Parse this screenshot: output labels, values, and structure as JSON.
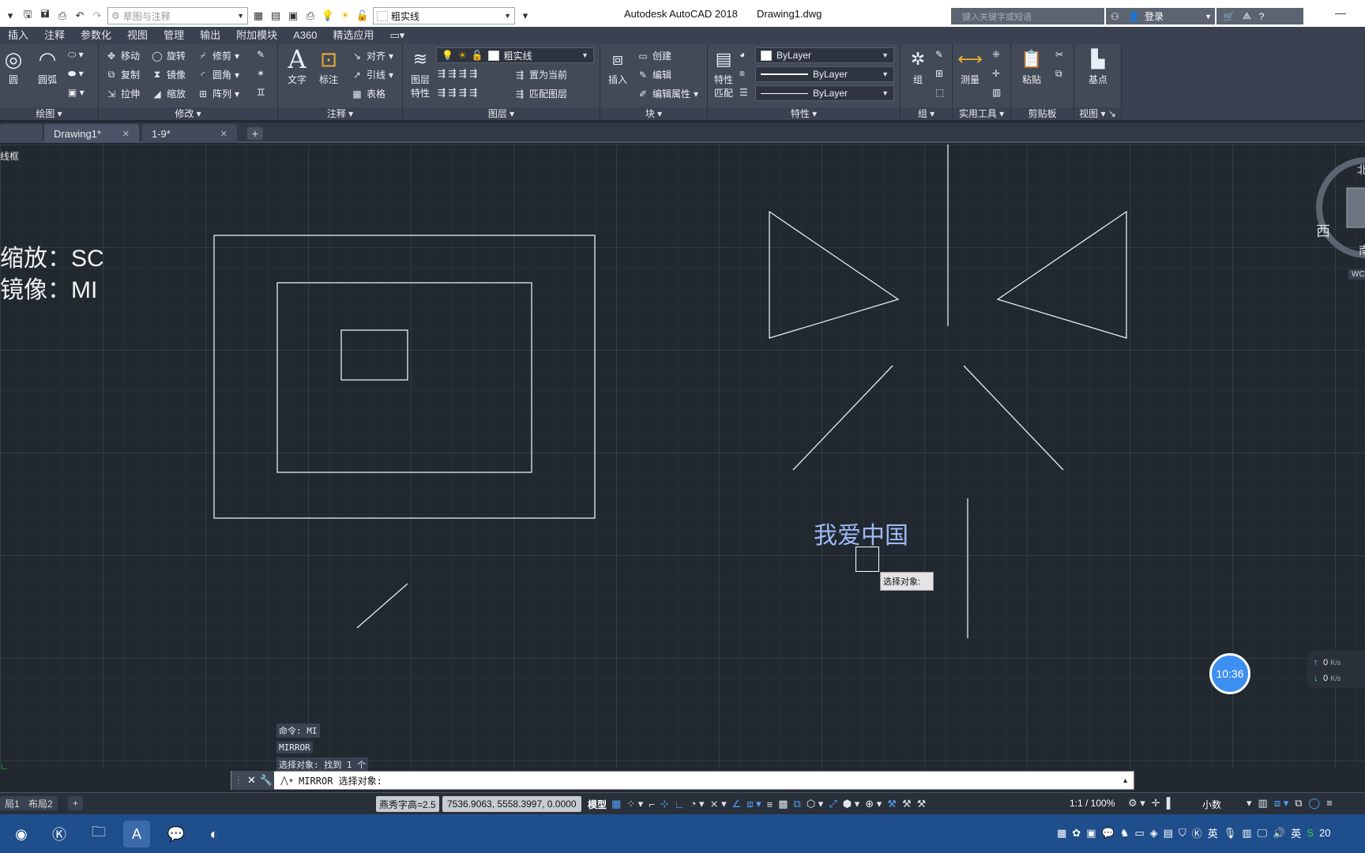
{
  "titlebar": {
    "workspace_placeholder": "草图与注释",
    "layer_name": "粗实线",
    "app_title": "Autodesk AutoCAD 2018",
    "doc_title": "Drawing1.dwg",
    "search_placeholder": "键入关键字或短语",
    "login_label": "登录",
    "minimize_glyph": "—"
  },
  "ribbon_tabs": [
    "插入",
    "注释",
    "参数化",
    "视图",
    "管理",
    "输出",
    "附加模块",
    "A360",
    "精选应用"
  ],
  "panels": {
    "draw": {
      "label": "绘图",
      "circle": "圆",
      "arc": "圆弧"
    },
    "modify": {
      "label": "修改",
      "move": "移动",
      "rotate": "旋转",
      "trim": "修剪",
      "copy": "复制",
      "mirror": "镜像",
      "fillet": "圆角",
      "stretch": "拉伸",
      "scale": "缩放",
      "array": "阵列"
    },
    "annotation": {
      "label": "注释",
      "text": "文字",
      "dimension": "标注",
      "align": "对齐",
      "leader": "引线",
      "table": "表格"
    },
    "layers": {
      "label": "图层",
      "layer_props_line1": "图层",
      "layer_props_line2": "特性",
      "layer_name": "粗实线",
      "set_current": "置为当前",
      "match_layer": "匹配图层"
    },
    "block": {
      "label": "块",
      "insert": "插入",
      "create": "创建",
      "edit": "编辑",
      "edit_attr": "编辑属性"
    },
    "properties": {
      "label": "特性",
      "match_line1": "特性",
      "match_line2": "匹配",
      "color": "ByLayer",
      "linetype": "ByLayer",
      "lineweight": "ByLayer"
    },
    "groups": {
      "label": "组",
      "group": "组"
    },
    "utilities": {
      "label": "实用工具",
      "measure": "测量"
    },
    "clipboard": {
      "label": "剪贴板",
      "paste": "粘贴"
    },
    "view": {
      "label": "视图",
      "base": "基点"
    }
  },
  "doc_tabs": [
    {
      "label": "Drawing1*",
      "active": true
    },
    {
      "label": "1-9*",
      "active": false
    }
  ],
  "canvas": {
    "viewport_label": "线框",
    "notes": [
      "缩放：SC",
      "镜像：MI"
    ],
    "text_object": "我爱中国",
    "tooltip": "选择对象:",
    "viewcube_west": "西",
    "viewcube_top_fragment": "北",
    "viewcube_bottom_fragment": "南",
    "wcs_label": "WCS",
    "clock": "10:36",
    "net_up": "0",
    "net_down": "0",
    "net_unit": "K/s"
  },
  "command": {
    "history": [
      "命令: MI",
      "MIRROR",
      "选择对象: 找到 1 个"
    ],
    "prompt": "MIRROR 选择对象:"
  },
  "statusbar": {
    "layout_tabs": [
      "局1",
      "布局2"
    ],
    "font": "燕秀字高=2.5",
    "coords": "7536.9063, 5558.3997, 0.0000",
    "model": "模型",
    "scale": "1:1 / 100%",
    "units": "小数"
  },
  "taskbar": {
    "ime": "英",
    "clock_fragment": "20"
  },
  "colors": {
    "canvas_bg": "#212830",
    "ribbon_bg": "#424a58",
    "text_object": "#9fb8f4",
    "taskbar": "#1f4e8c"
  }
}
